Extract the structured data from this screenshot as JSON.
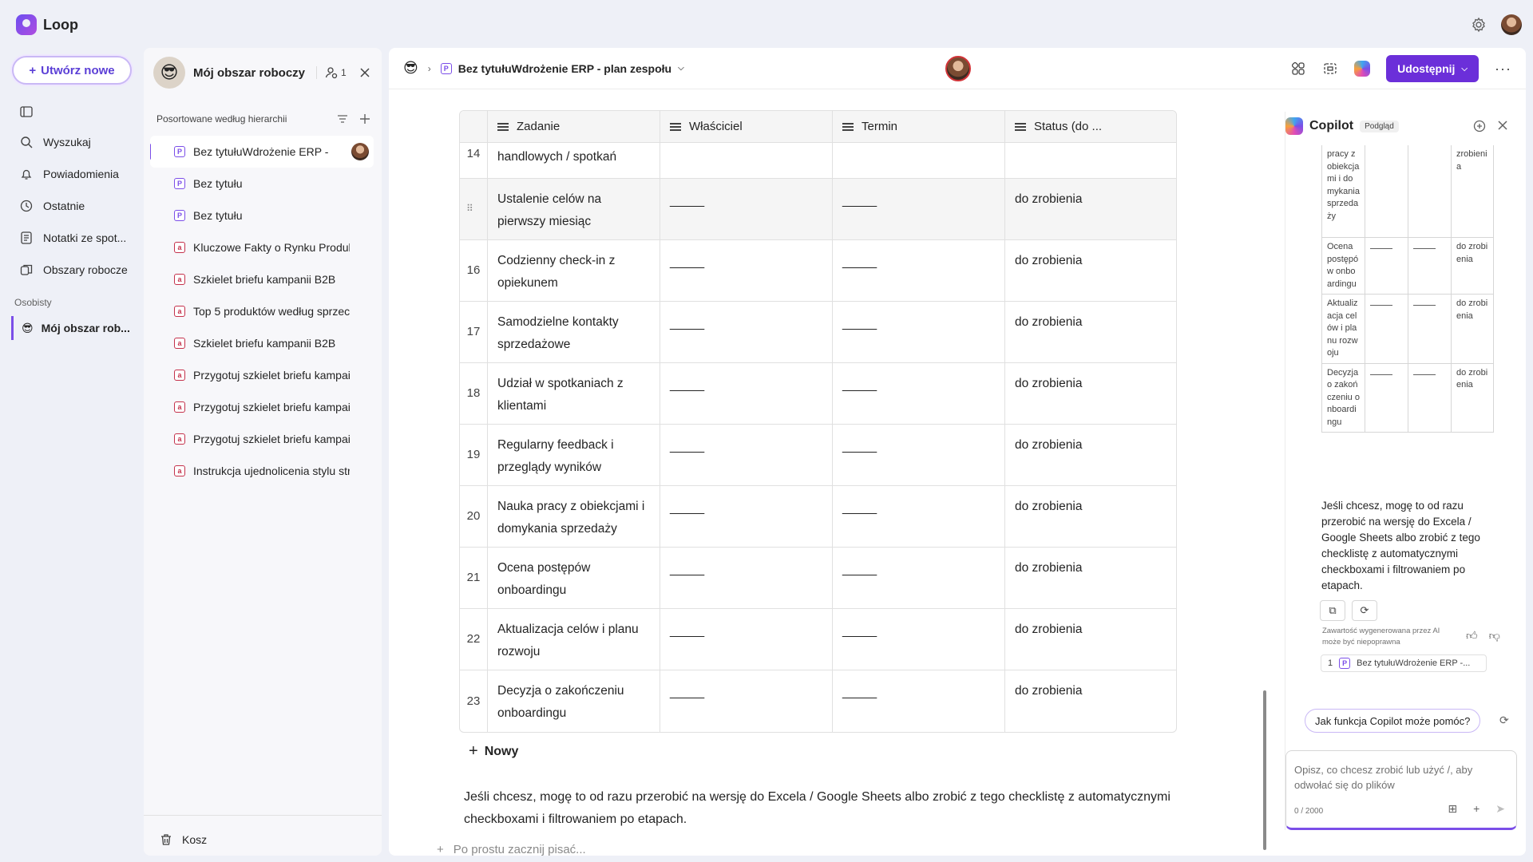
{
  "app": {
    "name": "Loop"
  },
  "nav": {
    "create_label": "Utwórz nowe",
    "items": [
      {
        "label": "Wyszukaj",
        "icon": "search-icon"
      },
      {
        "label": "Powiadomienia",
        "icon": "bell-icon"
      },
      {
        "label": "Ostatnie",
        "icon": "clock-icon"
      },
      {
        "label": "Notatki ze spot...",
        "icon": "notes-icon"
      },
      {
        "label": "Obszary robocze",
        "icon": "workspaces-icon"
      }
    ],
    "section_personal": "Osobisty",
    "workspace_label": "Mój obszar rob..."
  },
  "workspace": {
    "title": "Mój obszar roboczy",
    "member_count": "1",
    "sort_label": "Posortowane według hierarchii",
    "pages": [
      {
        "label": "Bez tytułuWdrożenie ERP -",
        "type": "loop",
        "active": true
      },
      {
        "label": "Bez tytułu",
        "type": "loop"
      },
      {
        "label": "Bez tytułu",
        "type": "loop"
      },
      {
        "label": "Kluczowe Fakty o Rynku Produk",
        "type": "doc"
      },
      {
        "label": "Szkielet briefu kampanii B2B",
        "type": "doc"
      },
      {
        "label": "Top 5 produktów według sprzec",
        "type": "doc"
      },
      {
        "label": "Szkielet briefu kampanii B2B",
        "type": "doc"
      },
      {
        "label": "Przygotuj szkielet briefu kampai",
        "type": "doc"
      },
      {
        "label": "Przygotuj szkielet briefu kampai",
        "type": "doc"
      },
      {
        "label": "Przygotuj szkielet briefu kampai",
        "type": "doc"
      },
      {
        "label": "Instrukcja ujednolicenia stylu str",
        "type": "doc"
      }
    ],
    "trash_label": "Kosz"
  },
  "doc": {
    "breadcrumb_title": "Bez tytułuWdrożenie ERP - plan zespołu",
    "share_label": "Udostępnij",
    "table": {
      "headers": [
        "Zadanie",
        "Właściciel",
        "Termin",
        "Status (do ..."
      ],
      "partial_row": {
        "num": "14",
        "task": "handlowych / spotkań"
      },
      "rows": [
        {
          "num": "",
          "task": "Ustalenie celów na pierwszy miesiąc",
          "owner": "_____",
          "due": "_____",
          "status": "do zrobienia"
        },
        {
          "num": "16",
          "task": "Codzienny check-in z opiekunem",
          "owner": "_____",
          "due": "_____",
          "status": "do zrobienia"
        },
        {
          "num": "17",
          "task": "Samodzielne kontakty sprzedażowe",
          "owner": "_____",
          "due": "_____",
          "status": "do zrobienia"
        },
        {
          "num": "18",
          "task": "Udział w spotkaniach z klientami",
          "owner": "_____",
          "due": "_____",
          "status": "do zrobienia"
        },
        {
          "num": "19",
          "task": "Regularny feedback i przeglądy wyników",
          "owner": "_____",
          "due": "_____",
          "status": "do zrobienia"
        },
        {
          "num": "20",
          "task": "Nauka pracy z obiekcjami i domykania sprzedaży",
          "owner": "_____",
          "due": "_____",
          "status": "do zrobienia"
        },
        {
          "num": "21",
          "task": "Ocena postępów onboardingu",
          "owner": "_____",
          "due": "_____",
          "status": "do zrobienia"
        },
        {
          "num": "22",
          "task": "Aktualizacja celów i planu rozwoju",
          "owner": "_____",
          "due": "_____",
          "status": "do zrobienia"
        },
        {
          "num": "23",
          "task": "Decyzja o zakończeniu onboardingu",
          "owner": "_____",
          "due": "_____",
          "status": "do zrobienia"
        }
      ],
      "new_label": "Nowy"
    },
    "paragraph": "Jeśli chcesz, mogę to od razu przerobić na wersję do Excela / Google Sheets albo zrobić z tego checklistę z automatycznymi checkboxami i filtrowaniem po etapach.",
    "placeholder": "Po prostu zacznij pisać..."
  },
  "copilot": {
    "title": "Copilot",
    "badge": "Podgląd",
    "mini_rows": [
      {
        "task": "pracy z obiekcjami i domykania sprzedaży",
        "status": "zrobienia"
      },
      {
        "task": "Ocena postępów onboardingu",
        "status": "do zrobienia"
      },
      {
        "task": "Aktualizacja celów i planu rozwoju",
        "status": "do zrobienia"
      },
      {
        "task": "Decyzja o zakończeniu onboardingu",
        "status": "do zrobienia"
      }
    ],
    "message": "Jeśli chcesz, mogę to od razu przerobić na wersję do Excela / Google Sheets albo zrobić z tego checklistę z automatycznymi checkboxami i filtrowaniem po etapach.",
    "disclaimer": "Zawartość wygenerowana przez AI może być niepoprawna",
    "ref_num": "1",
    "ref_title": "Bez tytułuWdrożenie ERP -...",
    "suggestion": "Jak funkcja Copilot może pomóc?",
    "input_placeholder": "Opisz, co chcesz zrobić lub użyć /, aby odwołać się do plików",
    "char_count": "0 / 2000"
  },
  "colors": {
    "accent": "#6b2fd9",
    "brand": "#7b4ee8",
    "background": "#eef0f7"
  }
}
